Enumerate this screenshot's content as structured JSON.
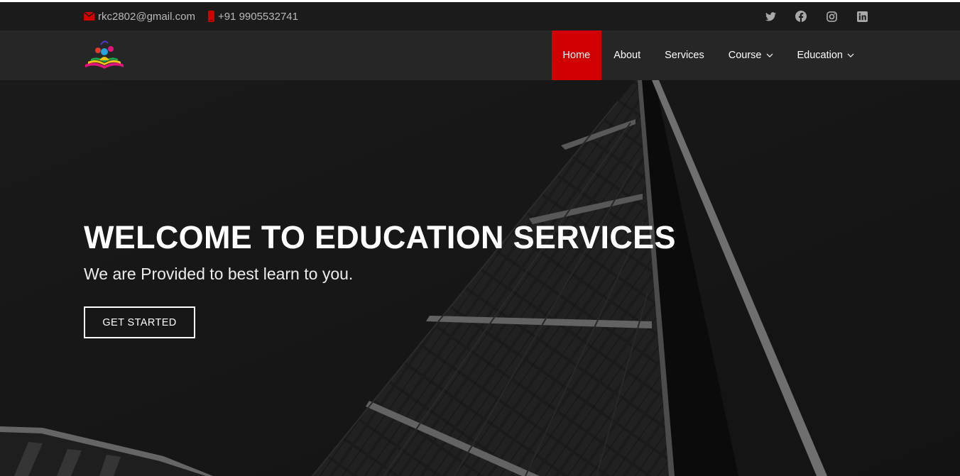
{
  "topbar": {
    "email": "rkc2802@gmail.com",
    "phone": "+91 9905532741",
    "email_icon": "envelope-icon",
    "phone_icon": "phone-icon",
    "socials": [
      "twitter-icon",
      "facebook-icon",
      "instagram-icon",
      "linkedin-icon"
    ]
  },
  "nav": {
    "items": [
      {
        "label": "Home",
        "active": true
      },
      {
        "label": "About"
      },
      {
        "label": "Services"
      },
      {
        "label": "Course",
        "dropdown": true
      },
      {
        "label": "Education",
        "dropdown": true
      }
    ]
  },
  "hero": {
    "title": "WELCOME TO EDUCATION SERVICES",
    "subtitle": "We are Provided to best learn to you.",
    "cta_label": "GET STARTED"
  },
  "colors": {
    "accent": "#d10000",
    "topbar_bg": "#1b1b1b",
    "header_bg": "#262626",
    "text_muted": "#b9b9b9"
  }
}
